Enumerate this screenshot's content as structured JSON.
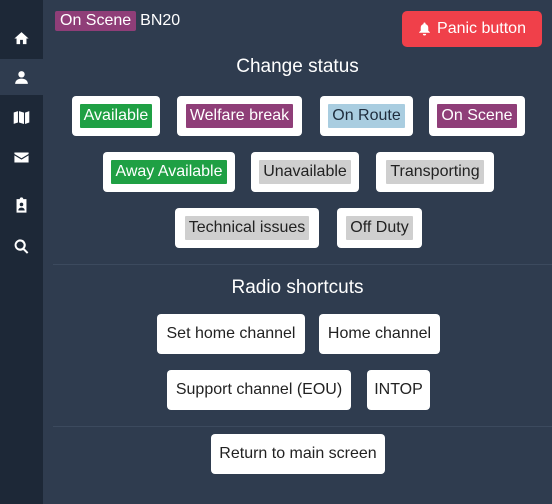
{
  "sidebar": {
    "items": [
      {
        "icon": "home-icon"
      },
      {
        "icon": "user-icon"
      },
      {
        "icon": "map-icon"
      },
      {
        "icon": "envelope-icon"
      },
      {
        "icon": "clipboard-user-icon"
      },
      {
        "icon": "search-icon"
      }
    ],
    "active_index": 1
  },
  "header": {
    "current_status": "On Scene",
    "current_status_color": "#8f3e78",
    "callsign": "BN20",
    "panic_label": "Panic button",
    "panic_color": "#f0404a"
  },
  "change_status": {
    "title": "Change status",
    "statuses": [
      {
        "label": "Available",
        "bg": "#1fa044",
        "fg": "#ffffff"
      },
      {
        "label": "Welfare break",
        "bg": "#8f3e78",
        "fg": "#ffffff"
      },
      {
        "label": "On Route",
        "bg": "#a9cde0",
        "fg": "#1f2d3d"
      },
      {
        "label": "On Scene",
        "bg": "#8f3e78",
        "fg": "#ffffff"
      },
      {
        "label": "Away Available",
        "bg": "#1fa044",
        "fg": "#ffffff"
      },
      {
        "label": "Unavailable",
        "bg": "#cfcfcf",
        "fg": "#222222"
      },
      {
        "label": "Transporting",
        "bg": "#cfcfcf",
        "fg": "#222222"
      },
      {
        "label": "Technical issues",
        "bg": "#cfcfcf",
        "fg": "#222222"
      },
      {
        "label": "Off Duty",
        "bg": "#cfcfcf",
        "fg": "#222222"
      }
    ]
  },
  "radio": {
    "title": "Radio shortcuts",
    "shortcuts": [
      "Set home channel",
      "Home channel",
      "Support channel (EOU)",
      "INTOP"
    ]
  },
  "return_label": "Return to main screen"
}
